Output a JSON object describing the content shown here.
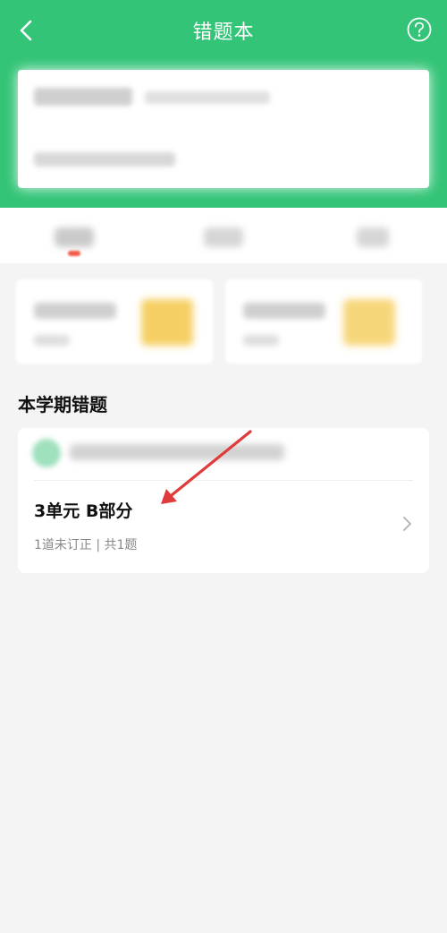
{
  "header": {
    "title": "错题本",
    "back_icon": "chevron-left-icon",
    "help_icon": "question-circle-icon"
  },
  "section": {
    "title": "本学期错题"
  },
  "error_item": {
    "title": "3单元 B部分",
    "meta": "1道未订正 | 共1题"
  },
  "colors": {
    "brand_green": "#33c477",
    "background": "#f4f4f4",
    "annotation_arrow": "#e03a3a"
  }
}
